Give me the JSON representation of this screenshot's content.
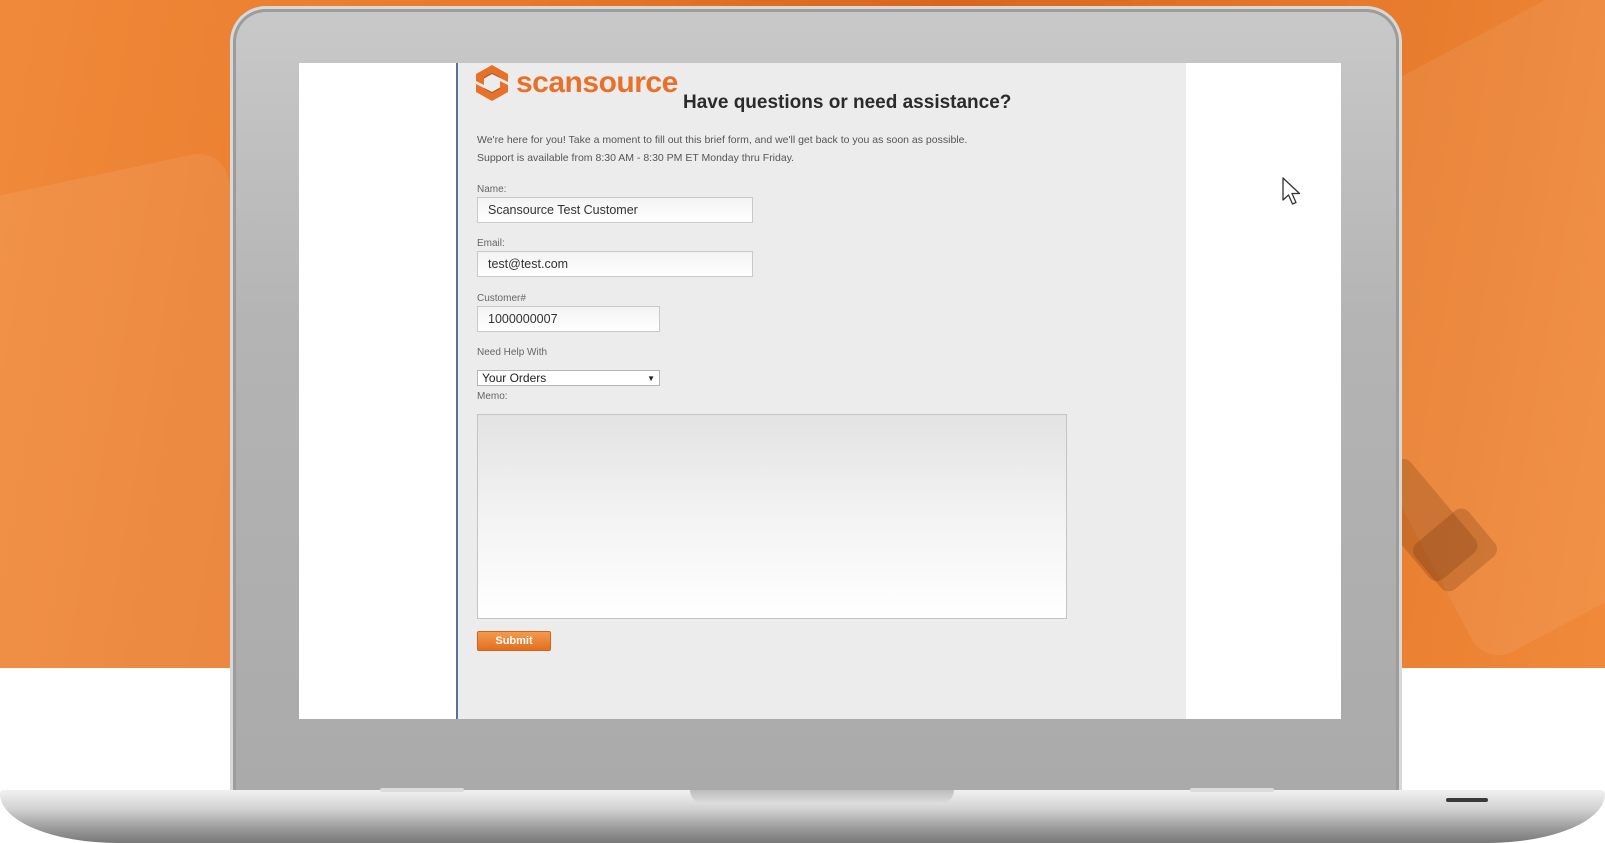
{
  "app": {
    "logo_text": "scansource",
    "logo_icon": "scansource-logo-mark"
  },
  "form": {
    "heading": "Have questions or need assistance?",
    "intro_line1": "We're here for you! Take a moment to fill out this brief form, and we'll get back to you as soon as possible.",
    "intro_line2": "Support is available from 8:30 AM - 8:30 PM ET Monday thru Friday.",
    "name_label": "Name:",
    "name_value": "Scansource Test Customer",
    "email_label": "Email:",
    "email_value": "test@test.com",
    "customer_label": "Customer#",
    "customer_value": "1000000007",
    "help_label": "Need Help With",
    "help_selected": "Your Orders",
    "memo_label": "Memo:",
    "memo_value": "",
    "submit_label": "Submit"
  },
  "colors": {
    "brand_orange": "#e8712a",
    "background_orange": "#e8782a",
    "page_bg": "#ececec"
  },
  "icons": {
    "cursor": "mouse-pointer-icon",
    "select_arrow": "dropdown-arrow-icon"
  }
}
